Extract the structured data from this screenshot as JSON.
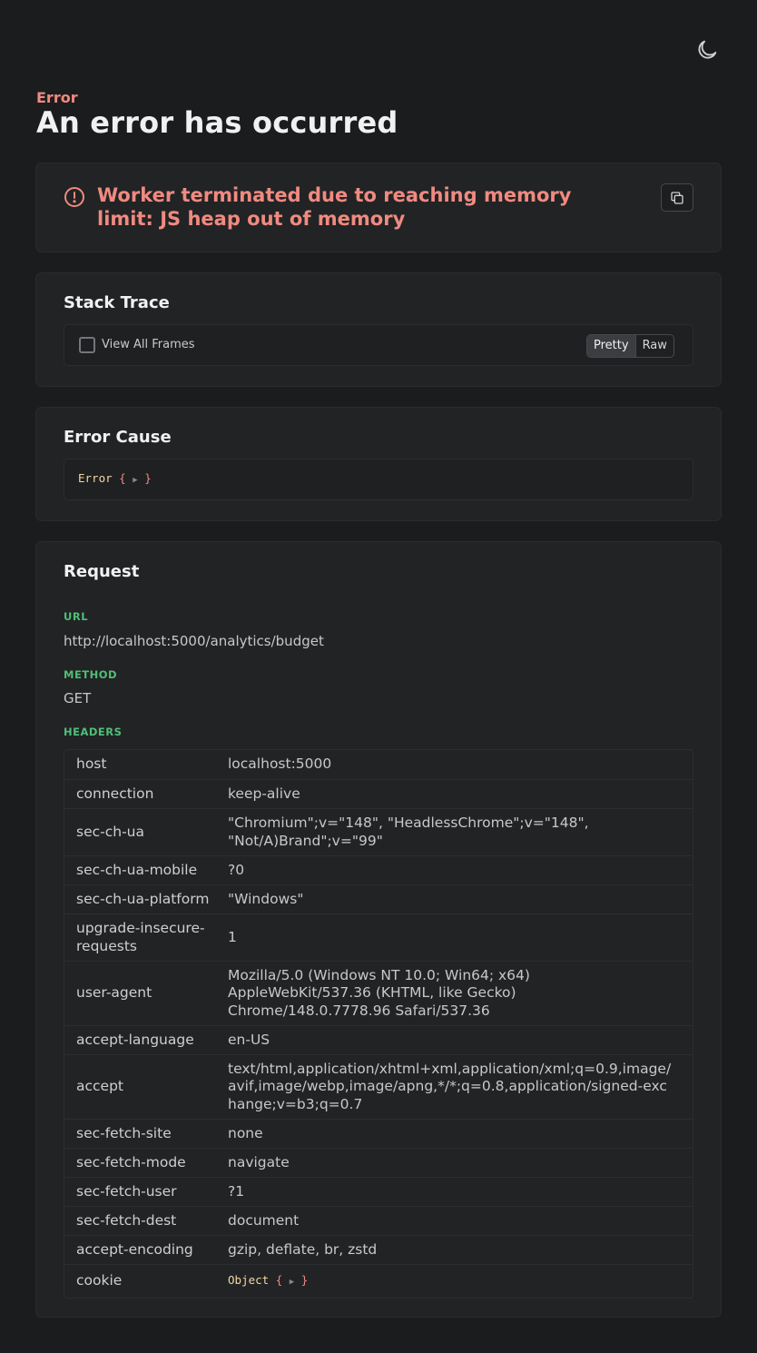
{
  "header": {
    "kicker": "Error",
    "title": "An error has occurred"
  },
  "theme_toggle": {
    "icon": "moon-icon"
  },
  "error_card": {
    "icon": "exclamation-circle-icon",
    "message": "Worker terminated due to reaching memory limit: JS heap out of memory",
    "copy_icon": "copy-icon"
  },
  "stack_trace": {
    "title": "Stack Trace",
    "view_all_frames_label": "View All Frames",
    "view_all_frames_checked": false,
    "modes": [
      "Pretty",
      "Raw"
    ],
    "active_mode": "Pretty"
  },
  "error_cause": {
    "title": "Error Cause",
    "type": "Error",
    "open_brace": "{",
    "arrow": "▶",
    "close_brace": "}"
  },
  "request": {
    "title": "Request",
    "url_label": "URL",
    "url": "http://localhost:5000/analytics/budget",
    "method_label": "METHOD",
    "method": "GET",
    "headers_label": "HEADERS",
    "headers": [
      {
        "key": "host",
        "value": "localhost:5000"
      },
      {
        "key": "connection",
        "value": "keep-alive"
      },
      {
        "key": "sec-ch-ua",
        "value": "\"Chromium\";v=\"148\", \"HeadlessChrome\";v=\"148\", \"Not/A)Brand\";v=\"99\""
      },
      {
        "key": "sec-ch-ua-mobile",
        "value": "?0"
      },
      {
        "key": "sec-ch-ua-platform",
        "value": "\"Windows\""
      },
      {
        "key": "upgrade-insecure-requests",
        "value": "1"
      },
      {
        "key": "user-agent",
        "value": "Mozilla/5.0 (Windows NT 10.0; Win64; x64) AppleWebKit/537.36 (KHTML, like Gecko) Chrome/148.0.7778.96 Safari/537.36"
      },
      {
        "key": "accept-language",
        "value": "en-US"
      },
      {
        "key": "accept",
        "value": "text/html,application/xhtml+xml,application/xml;q=0.9,image/avif,image/webp,image/apng,*/*;q=0.8,application/signed-exchange;v=b3;q=0.7"
      },
      {
        "key": "sec-fetch-site",
        "value": "none"
      },
      {
        "key": "sec-fetch-mode",
        "value": "navigate"
      },
      {
        "key": "sec-fetch-user",
        "value": "?1"
      },
      {
        "key": "sec-fetch-dest",
        "value": "document"
      },
      {
        "key": "accept-encoding",
        "value": "gzip, deflate, br, zstd"
      }
    ],
    "cookie": {
      "key": "cookie",
      "type": "Object",
      "open_brace": "{",
      "arrow": "▶",
      "close_brace": "}"
    }
  },
  "colors": {
    "background": "#1b1c1e",
    "card": "#222325",
    "error": "#f08a80",
    "label_green": "#4fbf76",
    "token_type": "#f0d9a0"
  }
}
